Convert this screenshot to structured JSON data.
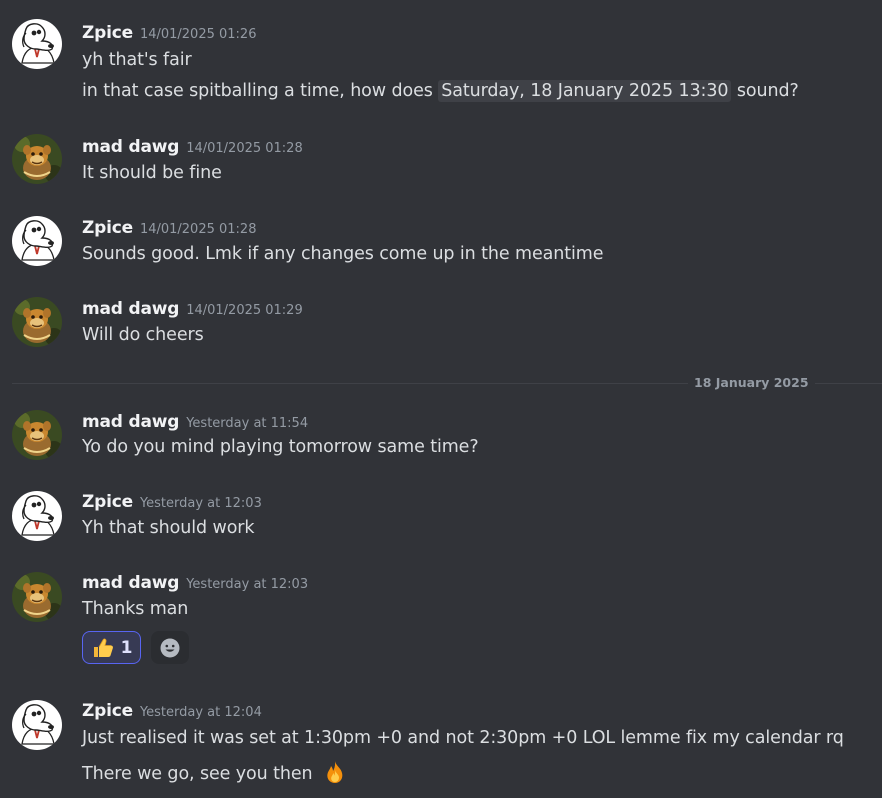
{
  "date_divider": "18 January 2025",
  "messages": [
    {
      "username": "Zpice",
      "timestamp": "14/01/2025 01:26",
      "lines": [
        "yh that's fair"
      ],
      "line2_pre": "in that case spitballing a time, how does ",
      "line2_chip": "Saturday, 18 January 2025 13:30",
      "line2_post": " sound?"
    },
    {
      "username": "mad dawg",
      "timestamp": "14/01/2025 01:28",
      "lines": [
        "It should be fine"
      ]
    },
    {
      "username": "Zpice",
      "timestamp": "14/01/2025 01:28",
      "lines": [
        "Sounds good. Lmk if any changes come up in the meantime"
      ]
    },
    {
      "username": "mad dawg",
      "timestamp": "14/01/2025 01:29",
      "lines": [
        "Will do cheers"
      ]
    },
    {
      "username": "mad dawg",
      "timestamp": "Yesterday at 11:54",
      "lines": [
        "Yo do you mind playing tomorrow same time?"
      ]
    },
    {
      "username": "Zpice",
      "timestamp": "Yesterday at 12:03",
      "lines": [
        "Yh that should work"
      ]
    },
    {
      "username": "mad dawg",
      "timestamp": "Yesterday at 12:03",
      "lines": [
        "Thanks man"
      ],
      "reaction": {
        "emoji": "thumbs-up",
        "count": "1"
      }
    },
    {
      "username": "Zpice",
      "timestamp": "Yesterday at 12:04",
      "lines": [
        "Just realised it was set at 1:30pm +0 and not 2:30pm +0 LOL lemme fix my calendar rq",
        "There we go, see you then"
      ],
      "trailing_emoji": "fire"
    }
  ],
  "colors": {
    "background": "#313338",
    "username": "#f2f3f5",
    "text": "#dbdee1",
    "muted": "#949ba4",
    "reaction_border": "#5865f2"
  }
}
